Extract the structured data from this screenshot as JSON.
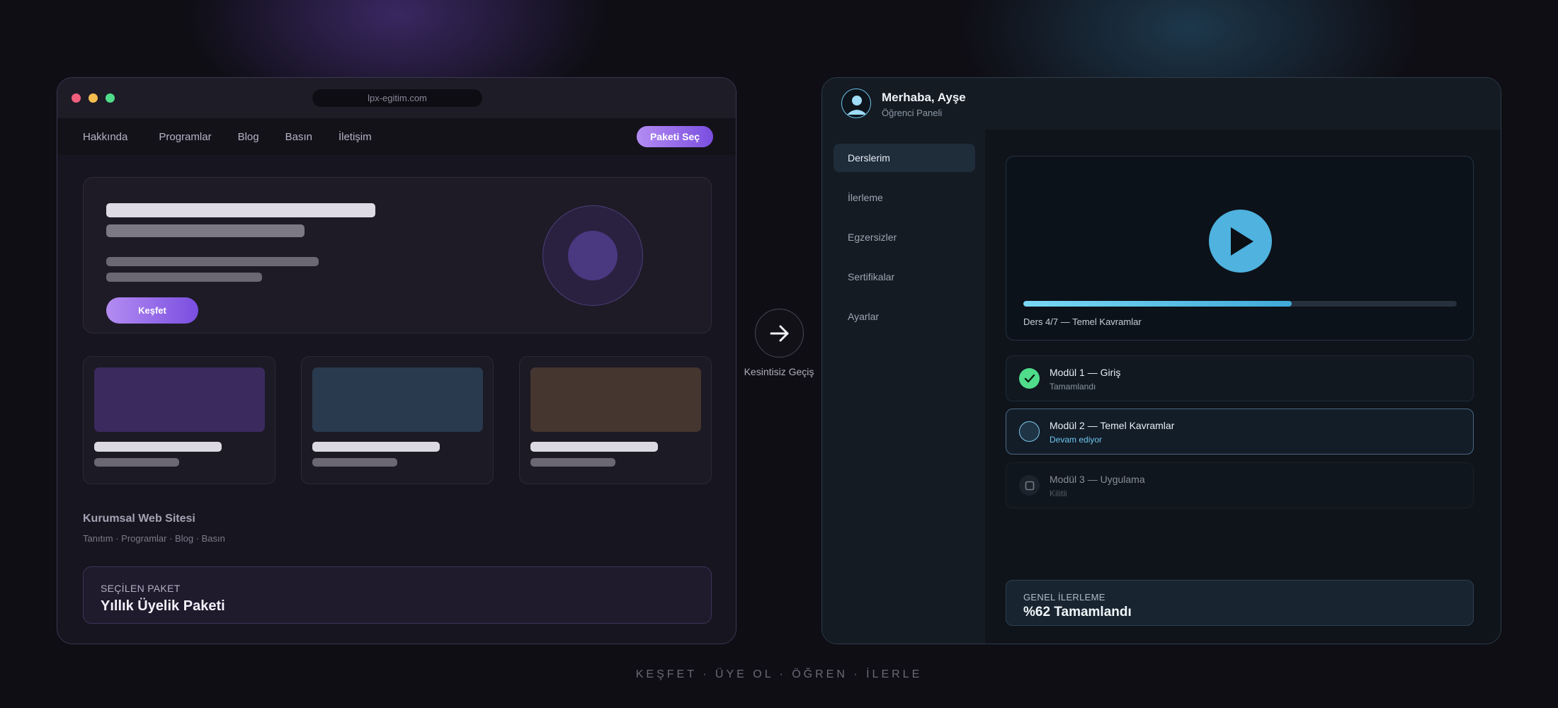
{
  "left_window": {
    "url": "lpx-egitim.com",
    "nav": {
      "items": [
        "Hakkında",
        "Programlar",
        "Blog",
        "Basın",
        "İletişim"
      ],
      "cta_label": "Paketi Seç"
    },
    "hero": {
      "button_label": "Keşfet"
    },
    "site": {
      "title": "Kurumsal Web Sitesi",
      "subtitle": "Tanıtım · Programlar · Blog · Basın"
    },
    "selected_package": {
      "label": "SEÇİLEN PAKET",
      "value": "Yıllık Üyelik Paketi"
    }
  },
  "transition": {
    "label": "Kesintisiz Geçiş",
    "icon": "arrow-right-icon"
  },
  "right_window": {
    "header": {
      "greeting": "Merhaba, Ayşe",
      "subtitle": "Öğrenci Paneli"
    },
    "sidebar": {
      "items": [
        {
          "label": "Derslerim",
          "active": true
        },
        {
          "label": "İlerleme",
          "active": false
        },
        {
          "label": "Egzersizler",
          "active": false
        },
        {
          "label": "Sertifikalar",
          "active": false
        },
        {
          "label": "Ayarlar",
          "active": false
        }
      ]
    },
    "player": {
      "lesson_label": "Ders 4/7 — Temel Kavramlar",
      "progress_percent": 62
    },
    "modules": [
      {
        "title": "Modül 1 — Giriş",
        "status": "Tamamlandı",
        "state": "done"
      },
      {
        "title": "Modül 2 — Temel Kavramlar",
        "status": "Devam ediyor",
        "state": "current"
      },
      {
        "title": "Modül 3 — Uygulama",
        "status": "Kilitli",
        "state": "locked"
      }
    ],
    "overall": {
      "label": "GENEL İLERLEME",
      "value": "%62 Tamamlandı"
    }
  },
  "footer_tagline": "KEŞFET · ÜYE OL · ÖĞREN · İLERLE",
  "colors": {
    "accent_purple": "#9b6ef0",
    "accent_blue": "#4fb2df",
    "success_green": "#4fdc8b"
  }
}
